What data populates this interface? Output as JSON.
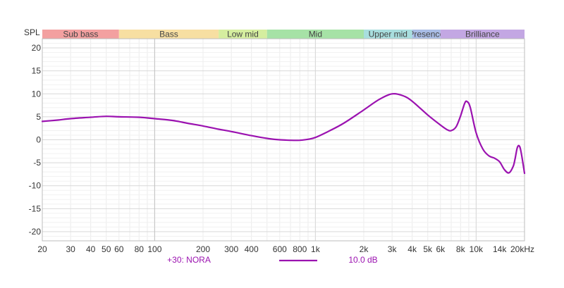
{
  "chart_data": {
    "type": "line",
    "ylabel": "SPL",
    "xunit": "kHz",
    "xscale": "log",
    "xlim": [
      20,
      20000
    ],
    "ylim": [
      -22,
      22
    ],
    "grid": true,
    "line_color": "#9b12b0",
    "bands": [
      {
        "label": "Sub bass",
        "from": 20,
        "to": 60,
        "color": "#f3a0a0"
      },
      {
        "label": "Bass",
        "from": 60,
        "to": 250,
        "color": "#f7dfa2"
      },
      {
        "label": "Low mid",
        "from": 250,
        "to": 500,
        "color": "#d5ee9f"
      },
      {
        "label": "Mid",
        "from": 500,
        "to": 2000,
        "color": "#a6e2a6"
      },
      {
        "label": "Upper mid",
        "from": 2000,
        "to": 4000,
        "color": "#a8dede"
      },
      {
        "label": "Presence",
        "from": 4000,
        "to": 6000,
        "color": "#a9bde6"
      },
      {
        "label": "Brilliance",
        "from": 6000,
        "to": 20000,
        "color": "#c3a7e3"
      }
    ],
    "x_ticks": [
      {
        "value": 20,
        "label": "20"
      },
      {
        "value": 30,
        "label": "30"
      },
      {
        "value": 40,
        "label": "40"
      },
      {
        "value": 50,
        "label": "50"
      },
      {
        "value": 60,
        "label": "60"
      },
      {
        "value": 80,
        "label": "80"
      },
      {
        "value": 100,
        "label": "100"
      },
      {
        "value": 200,
        "label": "200"
      },
      {
        "value": 300,
        "label": "300"
      },
      {
        "value": 400,
        "label": "400"
      },
      {
        "value": 600,
        "label": "600"
      },
      {
        "value": 800,
        "label": "800"
      },
      {
        "value": 1000,
        "label": "1k"
      },
      {
        "value": 2000,
        "label": "2k"
      },
      {
        "value": 3000,
        "label": "3k"
      },
      {
        "value": 4000,
        "label": "4k"
      },
      {
        "value": 5000,
        "label": "5k"
      },
      {
        "value": 6000,
        "label": "6k"
      },
      {
        "value": 8000,
        "label": "8k"
      },
      {
        "value": 10000,
        "label": "10k"
      },
      {
        "value": 14000,
        "label": "14k",
        "muted": true
      },
      {
        "value": 20000,
        "label": "20kHz"
      }
    ],
    "y_ticks": [
      20,
      15,
      10,
      5,
      0,
      -5,
      -10,
      -15,
      -20
    ],
    "series": [
      {
        "name": "+30: NORA",
        "legend_value": "10.0 dB",
        "x": [
          20,
          25,
          30,
          40,
          50,
          60,
          80,
          100,
          130,
          160,
          200,
          250,
          300,
          400,
          500,
          600,
          700,
          800,
          900,
          1000,
          1200,
          1500,
          2000,
          2500,
          3000,
          3500,
          4000,
          5000,
          6000,
          6600,
          7000,
          7500,
          8000,
          8500,
          8800,
          9200,
          10000,
          11000,
          12000,
          13000,
          14000,
          15000,
          16000,
          17000,
          17500,
          18000,
          18500,
          19000,
          20000
        ],
        "y": [
          4.0,
          4.3,
          4.6,
          4.9,
          5.1,
          5.0,
          4.9,
          4.6,
          4.2,
          3.6,
          3.0,
          2.3,
          1.8,
          0.9,
          0.3,
          0.0,
          -0.1,
          -0.1,
          0.1,
          0.5,
          1.8,
          3.6,
          6.5,
          8.8,
          10.0,
          9.6,
          8.4,
          5.4,
          3.2,
          2.2,
          2.0,
          2.8,
          5.2,
          8.0,
          8.3,
          7.0,
          1.5,
          -2.0,
          -3.5,
          -4.0,
          -4.8,
          -6.5,
          -7.2,
          -5.8,
          -4.0,
          -1.8,
          -1.3,
          -2.5,
          -7.3
        ]
      }
    ]
  }
}
